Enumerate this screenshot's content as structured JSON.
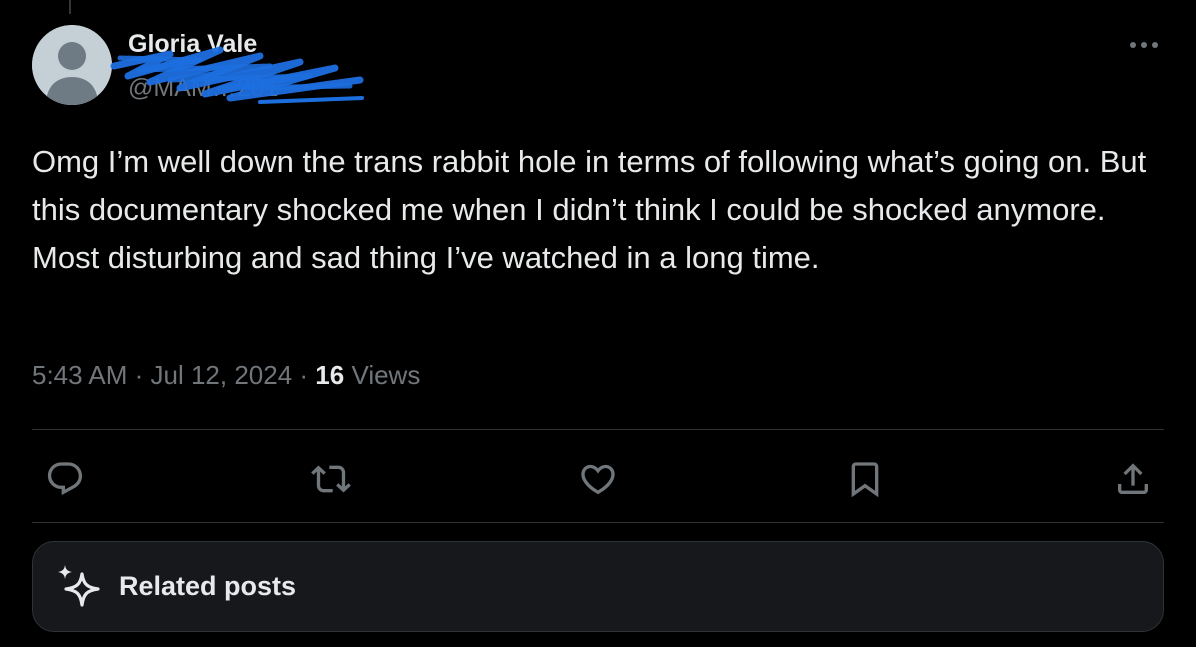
{
  "author": {
    "name": "Gloria Vale",
    "handle": "@MAM…201"
  },
  "tweet": {
    "text": "Omg I’m well down the trans rabbit hole in terms of following what’s going on. But this documentary shocked me when I didn’t think I could be shocked anymore. Most disturbing and sad thing I’ve watched in a long time.",
    "time": "5:43 AM",
    "separator": " · ",
    "date": "Jul 12, 2024",
    "views_count": "16",
    "views_label": " Views"
  },
  "actions": [
    "reply-icon",
    "retweet-icon",
    "like-icon",
    "bookmark-icon",
    "share-icon"
  ],
  "related": {
    "label": "Related posts"
  },
  "colors": {
    "background": "#000000",
    "text": "#e7e9ea",
    "muted": "#71767b",
    "divider": "#2f3336",
    "redaction": "#1d6fe0"
  }
}
